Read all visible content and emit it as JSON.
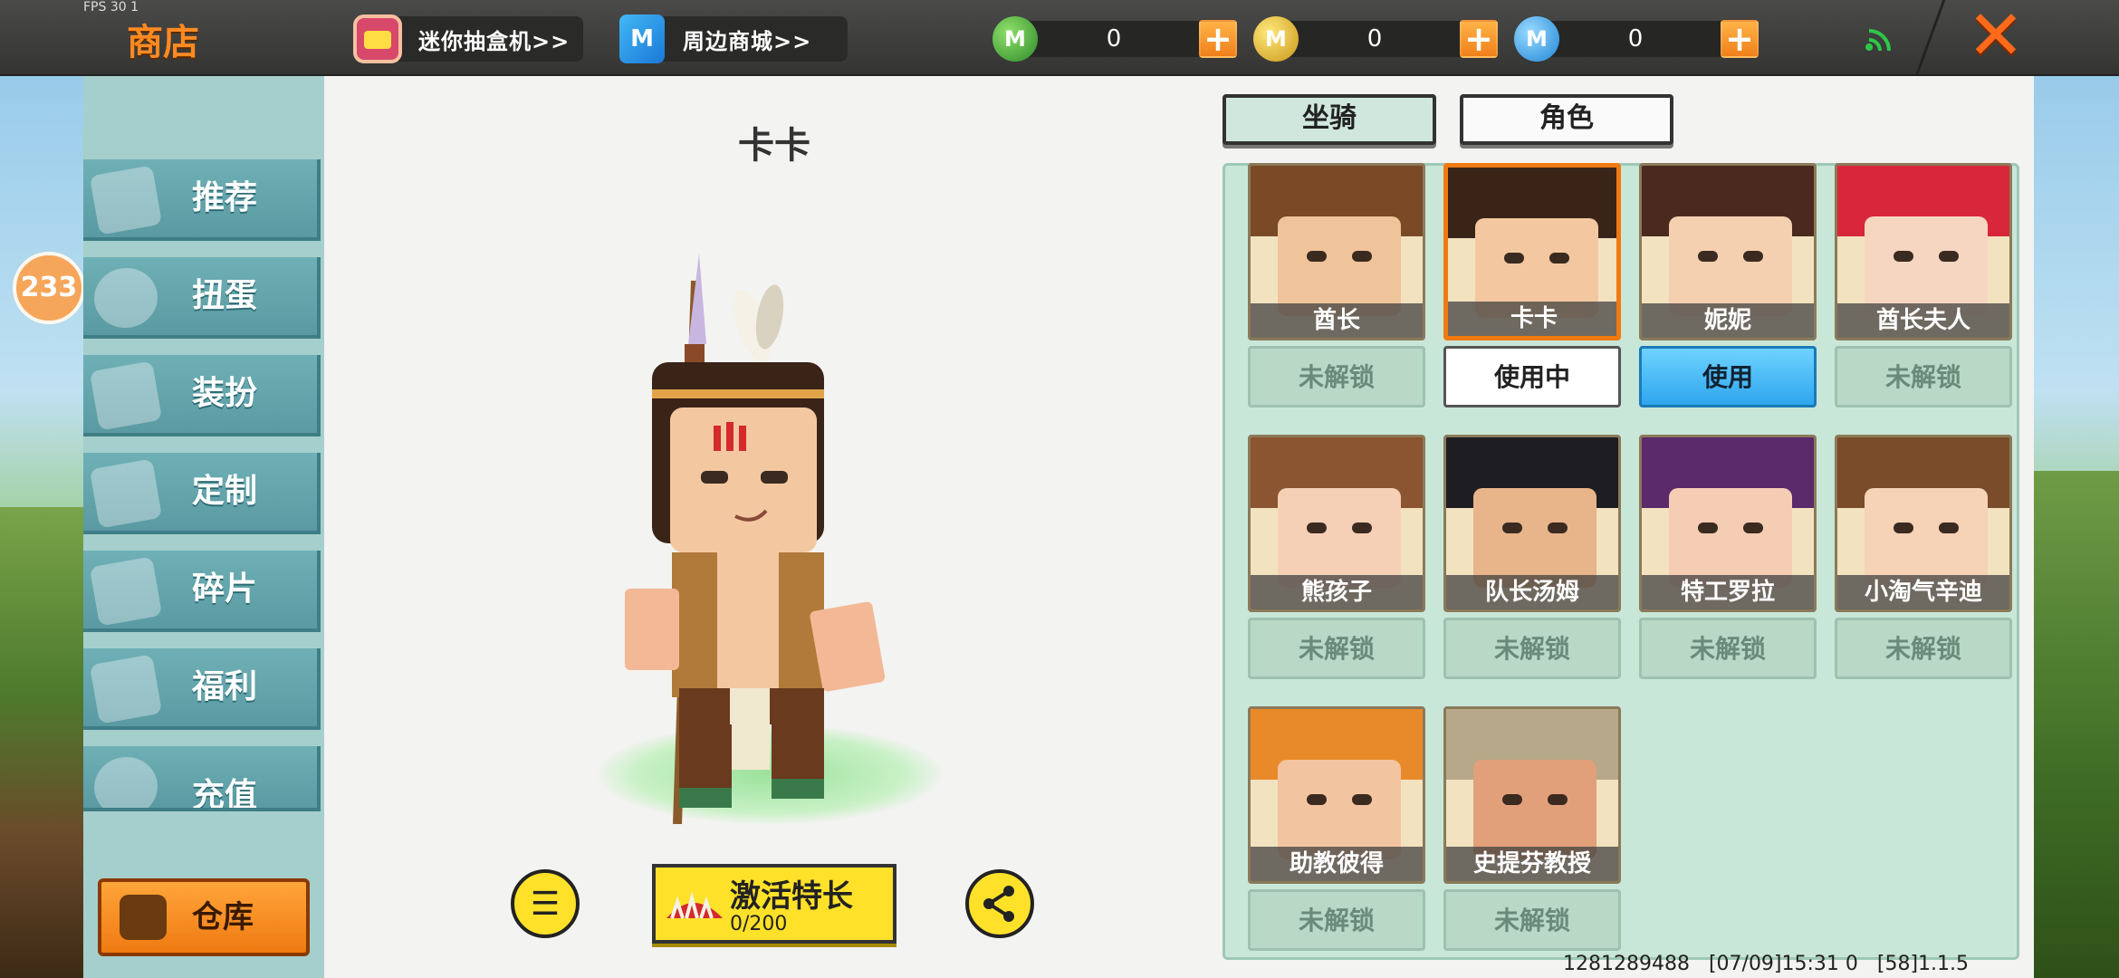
{
  "topbar": {
    "fps": "FPS 30 1",
    "title": "商店",
    "links": [
      {
        "label": "迷你抽盒机>>",
        "icon": "blind-box-tv-icon"
      },
      {
        "label": "周边商城>>",
        "icon": "shopping-bag-icon"
      }
    ],
    "currencies": [
      {
        "icon": "green-gem-coin-icon",
        "value": "0",
        "color": "#3fae3a"
      },
      {
        "icon": "gold-mini-coin-icon",
        "value": "0",
        "color": "#e6b821"
      },
      {
        "icon": "blue-mini-coin-icon",
        "value": "0",
        "color": "#3fa4e8"
      }
    ],
    "signal_icon": "signal-icon",
    "close_icon": "close-icon"
  },
  "badge": "233",
  "sidebar": {
    "items": [
      {
        "label": "推荐",
        "icon": "thumbs-up-icon"
      },
      {
        "label": "扭蛋",
        "icon": "capsule-icon"
      },
      {
        "label": "装扮",
        "icon": "shirt-icon"
      },
      {
        "label": "定制",
        "icon": "pencil-icon"
      },
      {
        "label": "碎片",
        "icon": "puzzle-icon"
      },
      {
        "label": "福利",
        "icon": "gift-icon"
      },
      {
        "label": "充值",
        "icon": "coin-stack-icon"
      }
    ],
    "warehouse_label": "仓库"
  },
  "preview": {
    "name": "卡卡",
    "activate_label": "激活特长",
    "activate_progress": "0/200"
  },
  "tabs": {
    "mount": "坐骑",
    "role": "角色"
  },
  "roles": [
    {
      "name": "酋长",
      "status": "未解锁",
      "state": "locked",
      "hair": "#7a4a26",
      "skin": "#f0c49a"
    },
    {
      "name": "卡卡",
      "status": "使用中",
      "state": "using",
      "hair": "#3a2418",
      "skin": "#f3c8a0"
    },
    {
      "name": "妮妮",
      "status": "使用",
      "state": "use",
      "hair": "#4a2a1e",
      "skin": "#f4d0b0"
    },
    {
      "name": "酋长夫人",
      "status": "未解锁",
      "state": "locked",
      "hair": "#d8263a",
      "skin": "#f6d6c0"
    },
    {
      "name": "熊孩子",
      "status": "未解锁",
      "state": "locked",
      "hair": "#8a5530",
      "skin": "#f6d0b6"
    },
    {
      "name": "队长汤姆",
      "status": "未解锁",
      "state": "locked",
      "hair": "#1e1e22",
      "skin": "#e8b48a"
    },
    {
      "name": "特工罗拉",
      "status": "未解锁",
      "state": "locked",
      "hair": "#5a2a6a",
      "skin": "#f4cdb4"
    },
    {
      "name": "小淘气辛迪",
      "status": "未解锁",
      "state": "locked",
      "hair": "#7a4c2a",
      "skin": "#f6d2b6"
    },
    {
      "name": "助教彼得",
      "status": "未解锁",
      "state": "locked",
      "hair": "#e88a2a",
      "skin": "#f3c4a0"
    },
    {
      "name": "史提芬教授",
      "status": "未解锁",
      "state": "locked",
      "hair": "#b6a888",
      "skin": "#e2a07a"
    }
  ],
  "footer": {
    "text": "1281289488   [07/09]15:31 0   [58]1.1.5"
  }
}
